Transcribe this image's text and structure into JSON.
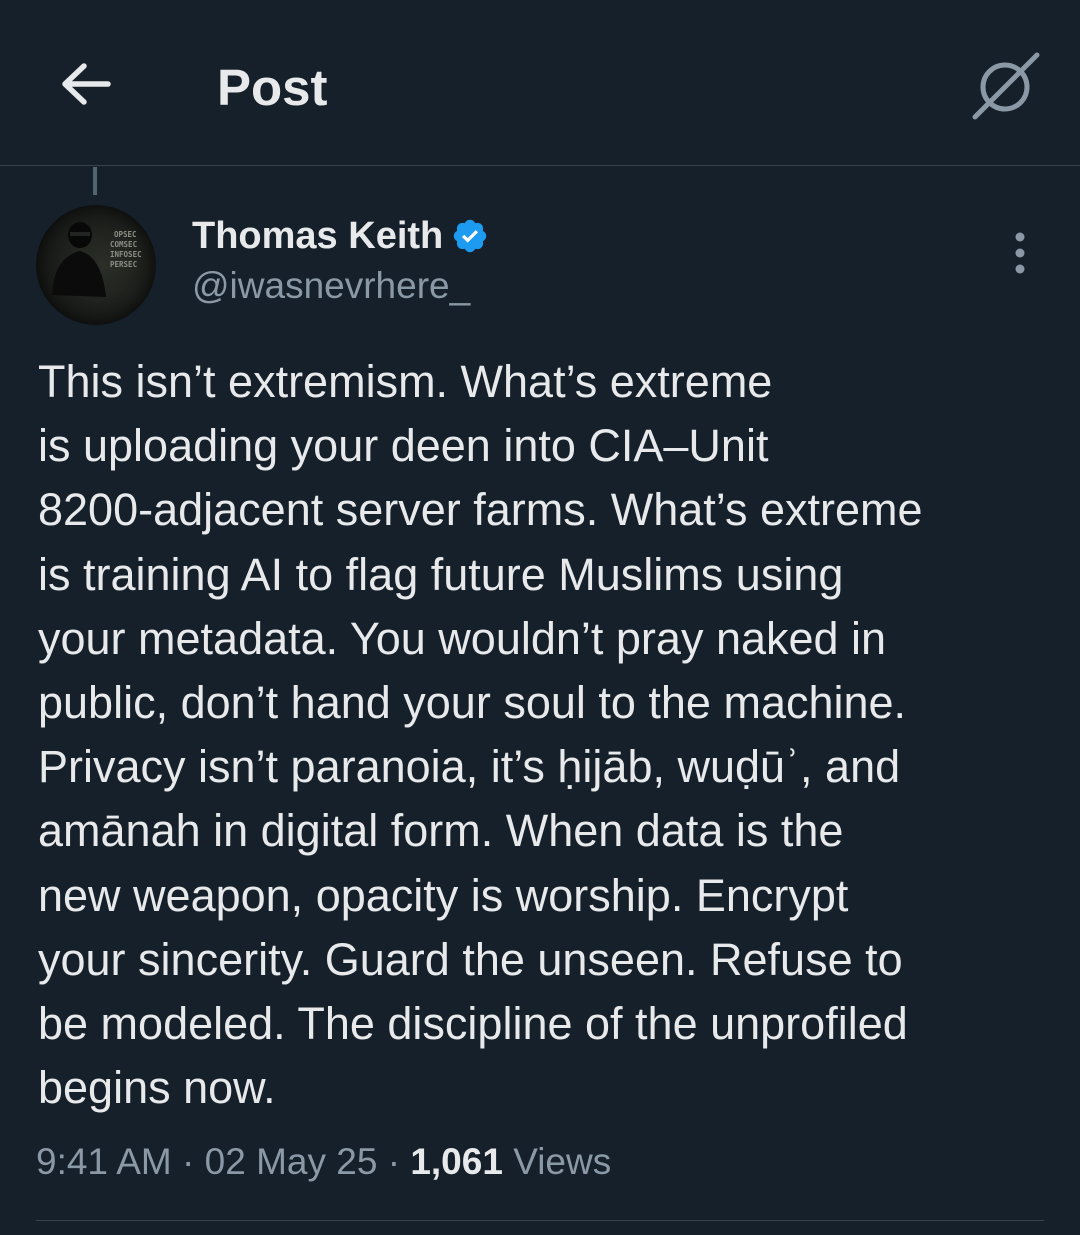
{
  "header": {
    "title": "Post",
    "back_icon": "arrow-left-icon",
    "grok_icon": "grok-icon"
  },
  "author": {
    "name": "Thomas Keith",
    "handle": "@iwasnevrhere_",
    "verified": true,
    "avatar_text": [
      "OPSEC",
      "COMSEC",
      "INFOSEC",
      "PERSEC"
    ]
  },
  "post": {
    "text": "This isn’t extremism. What’s extreme\nis uploading your deen into CIA–Unit\n8200-adjacent server farms. What’s extreme\nis training AI to flag future Muslims using\nyour metadata. You wouldn’t pray naked in\npublic, don’t hand your soul to the machine.\nPrivacy isn’t paranoia, it’s ḥijāb, wuḍūʾ, and\namānah in digital form. When data is the\nnew weapon, opacity is worship. Encrypt\nyour sincerity. Guard the unseen. Refuse to\nbe modeled. The discipline of the unprofiled\nbegins now.",
    "time": "9:41 AM",
    "separator": " · ",
    "date": "02 May 25",
    "views_count": "1,061",
    "views_label": "Views"
  },
  "colors": {
    "background": "#15202b",
    "text": "#e7e9ea",
    "secondary": "#8b98a5",
    "verified": "#1d9bf0",
    "divider": "#38444d"
  }
}
